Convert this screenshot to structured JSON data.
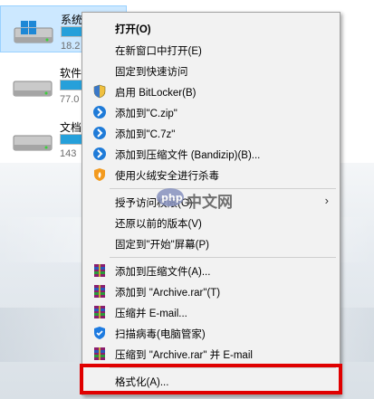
{
  "drives": [
    {
      "name": "系统 (C:)",
      "size": "18.2",
      "fill_percent": 70,
      "selected": true
    },
    {
      "name": "软件",
      "size": "77.0",
      "fill_percent": 55,
      "selected": false
    },
    {
      "name": "文档",
      "size": "143",
      "fill_percent": 40,
      "selected": false
    }
  ],
  "menu": {
    "open": "打开(O)",
    "open_new_window": "在新窗口中打开(E)",
    "pin_quick_access": "固定到快速访问",
    "bitlocker": "启用 BitLocker(B)",
    "add_zip": "添加到\"C.zip\"",
    "add_7z": "添加到\"C.7z\"",
    "add_bandizip": "添加到压缩文件 (Bandizip)(B)...",
    "huorong_scan": "使用火绒安全进行杀毒",
    "grant_access": "授予访问权限(G)",
    "restore_versions": "还原以前的版本(V)",
    "pin_start": "固定到\"开始\"屏幕(P)",
    "rar_add_archive": "添加到压缩文件(A)...",
    "rar_add_archive_rar": "添加到 \"Archive.rar\"(T)",
    "rar_compress_email": "压缩并 E-mail...",
    "scan_virus": "扫描病毒(电脑管家)",
    "rar_compress_to_email": "压缩到 \"Archive.rar\" 并 E-mail",
    "format": "格式化(A)..."
  },
  "watermark": {
    "text": "中文网"
  },
  "icons": {
    "drive": "hard-drive-icon",
    "windows_logo": "windows-logo-icon",
    "shield": "shield-icon",
    "bandizip": "bandizip-icon",
    "huorong": "flame-shield-icon",
    "winrar": "winrar-icon",
    "pc_manager": "pc-manager-shield-icon"
  },
  "colors": {
    "selection": "#cce8ff",
    "drive_bar": "#26a0da",
    "menu_bg": "#f2f2f2",
    "highlight_border": "#e00000"
  }
}
